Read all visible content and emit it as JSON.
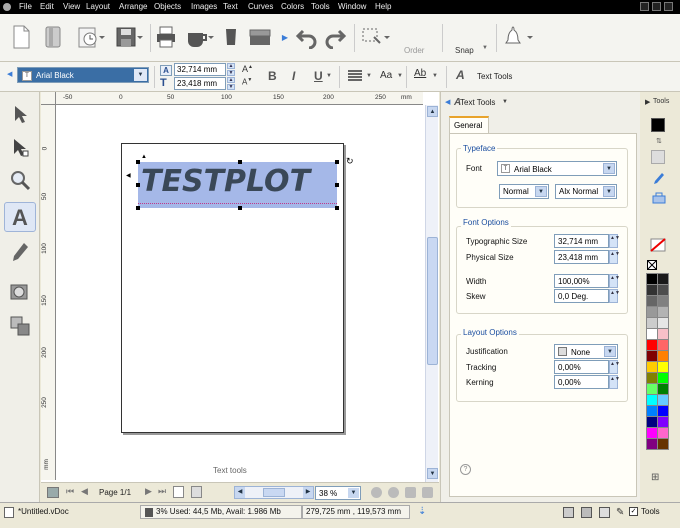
{
  "menu": {
    "items": [
      "File",
      "Edit",
      "View",
      "Layout",
      "Arrange",
      "Objects",
      "Images",
      "Text",
      "Curves",
      "Colors",
      "Tools",
      "Window",
      "Help"
    ]
  },
  "toolbar": {
    "order_label": "Order",
    "snap_label": "Snap"
  },
  "text_toolbar": {
    "font_name": "Arial Black",
    "width_value": "32,714 mm",
    "height_value": "23,418 mm",
    "bold": "B",
    "italic": "I",
    "underline": "U",
    "case_label": "Aa",
    "kern_label": "Ab",
    "text_tools_label": "Text Tools"
  },
  "ruler": {
    "h_labels": [
      "-50",
      "0",
      "50",
      "100",
      "150",
      "200",
      "250",
      "mm"
    ],
    "v_labels": [
      "0",
      "50",
      "100",
      "150",
      "200",
      "250",
      "mm"
    ]
  },
  "canvas": {
    "text": "TESTPLOT",
    "footer_label": "Text tools"
  },
  "navigation": {
    "page_label": "Page 1/1",
    "zoom_value": "38 %"
  },
  "panel": {
    "header_title": "Text Tools",
    "tab_general": "General",
    "side_tab": "Tools",
    "typeface": {
      "title": "Typeface",
      "font_label": "Font",
      "font_value": "Arial Black",
      "style_value": "Normal",
      "style2_value": "Alx Normal"
    },
    "font_options": {
      "title": "Font Options",
      "typographic_label": "Typographic Size",
      "typographic_value": "32,714 mm",
      "physical_label": "Physical Size",
      "physical_value": "23,418 mm",
      "width_label": "Width",
      "width_value": "100,00%",
      "skew_label": "Skew",
      "skew_value": "0,0 Deg."
    },
    "layout_options": {
      "title": "Layout Options",
      "justification_label": "Justification",
      "justification_value": "None",
      "tracking_label": "Tracking",
      "tracking_value": "0,00%",
      "kerning_label": "Kerning",
      "kerning_value": "0,00%"
    }
  },
  "status": {
    "doc_name": "*Untitled.vDoc",
    "memory": "3%  Used: 44,5 Mb, Avail: 1.986 Mb",
    "coords": "279,725 mm , 119,573 mm",
    "tools_label": "Tools"
  },
  "palette_colors": [
    "#000000",
    "#1a1a1a",
    "#333333",
    "#4d4d4d",
    "#666666",
    "#808080",
    "#999999",
    "#b3b3b3",
    "#cccccc",
    "#e6e6e6",
    "#ffffff",
    "#f7c0c8",
    "#ff0000",
    "#ff6666",
    "#800000",
    "#ff8000",
    "#ffcc00",
    "#ffff00",
    "#808000",
    "#00ff00",
    "#66ff66",
    "#008000",
    "#00ffff",
    "#66ccff",
    "#0080ff",
    "#0000ff",
    "#000080",
    "#8000ff",
    "#ff00ff",
    "#ff66cc",
    "#800080",
    "#663300"
  ]
}
